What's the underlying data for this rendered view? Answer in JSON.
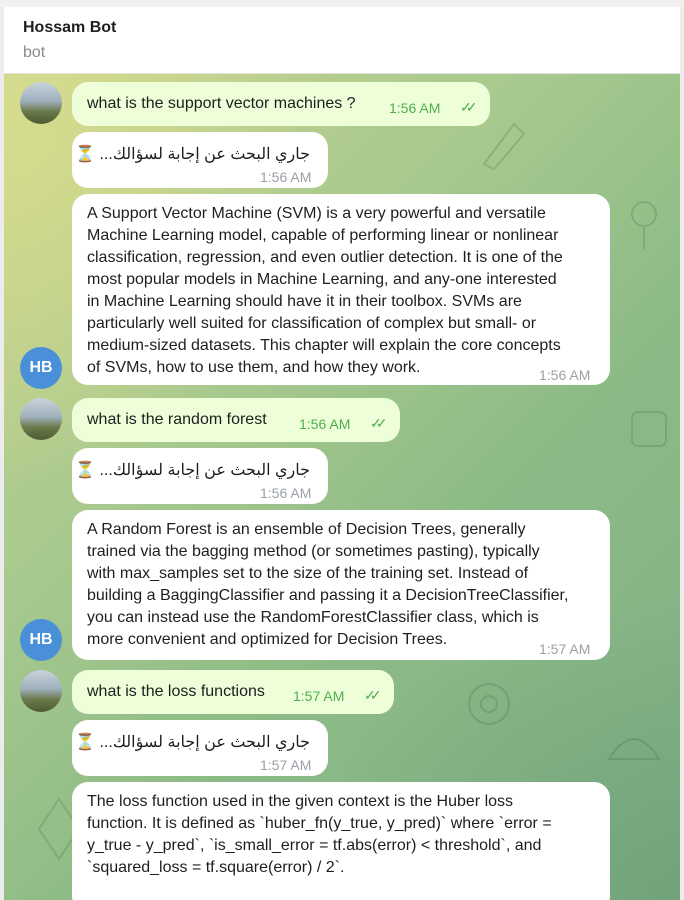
{
  "header": {
    "title": "Hossam Bot",
    "subtitle": "bot"
  },
  "avatar_initials": "HB",
  "messages": [
    {
      "question": "what is the support vector machines ?",
      "q_time": "1:56 AM",
      "wait_text": "جاري البحث عن إجابة لسؤالك...",
      "wait_time": "1:56 AM",
      "answer": "A Support Vector Machine (SVM) is a very powerful and versatile\nMachine Learning model, capable of performing linear or nonlinear\nclassification, regression, and even outlier detection. It is one of the\nmost popular models in Machine Learning, and any-one interested\nin Machine Learning should have it in their toolbox. SVMs are\nparticularly well suited for classification of complex but small- or\nmedium-sized datasets. This chapter will explain the core concepts\nof SVMs, how to use them, and how they work.",
      "a_time": "1:56 AM"
    },
    {
      "question": "what is the random forest",
      "q_time": "1:56 AM",
      "wait_text": "جاري البحث عن إجابة لسؤالك...",
      "wait_time": "1:56 AM",
      "answer": "A Random Forest is an ensemble of Decision Trees, generally\ntrained via the bagging method (or sometimes pasting), typically\nwith max_samples set to the size of the training set. Instead of\nbuilding a BaggingClassifier and passing it a DecisionTreeClassifier,\nyou can instead use the RandomForestClassifier class, which is\nmore convenient and optimized for Decision Trees.",
      "a_time": "1:57 AM"
    },
    {
      "question": "what is the loss functions",
      "q_time": "1:57 AM",
      "wait_text": "جاري البحث عن إجابة لسؤالك...",
      "wait_time": "1:57 AM",
      "answer": "The loss function used in the given context is the Huber loss\nfunction. It is defined as `huber_fn(y_true, y_pred)` where `error =\ny_true - y_pred`, `is_small_error = tf.abs(error) < threshold`, and\n`squared_loss = tf.square(error) / 2`."
    }
  ]
}
